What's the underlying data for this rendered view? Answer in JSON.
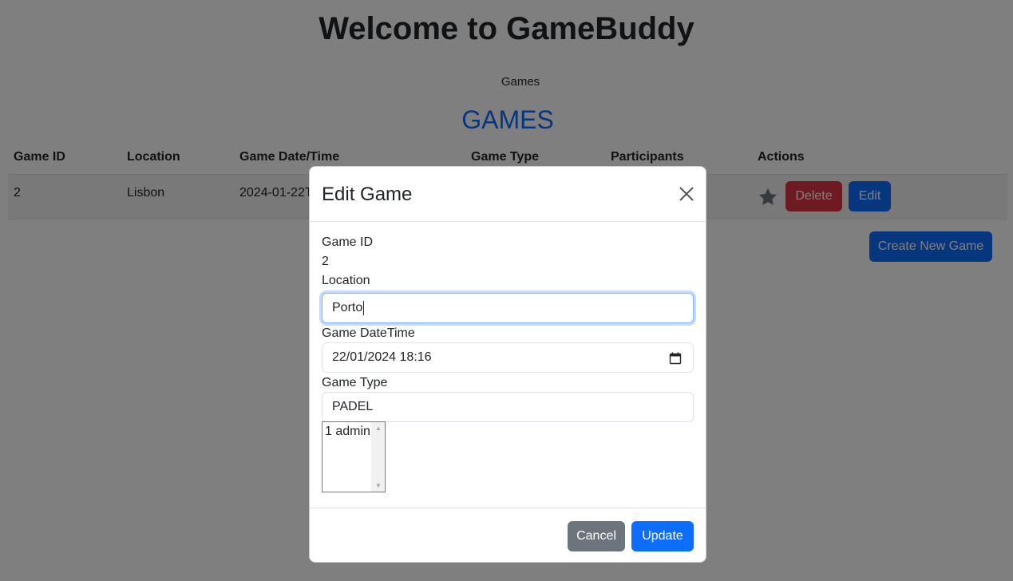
{
  "page": {
    "title": "Welcome to GameBuddy",
    "nav_link": "Games",
    "section_heading": "GAMES",
    "create_button": "Create New Game"
  },
  "table": {
    "headers": [
      "Game ID",
      "Location",
      "Game Date/Time",
      "Game Type",
      "Participants",
      "Actions"
    ],
    "rows": [
      {
        "id": "2",
        "location": "Lisbon",
        "datetime": "2024-01-22T",
        "type": "",
        "participants": ""
      }
    ],
    "delete_label": "Delete",
    "edit_label": "Edit",
    "favorite_icon": "star-icon"
  },
  "modal": {
    "title": "Edit Game",
    "close_icon": "close-icon",
    "game_id_label": "Game ID",
    "game_id_value": "2",
    "location_label": "Location",
    "location_value": "Porto",
    "datetime_label": "Game DateTime",
    "datetime_value": "22/01/2024 18:16",
    "calendar_icon": "calendar-icon",
    "type_label": "Game Type",
    "type_value": "PADEL",
    "participants_options": [
      "1 admin"
    ],
    "cancel_label": "Cancel",
    "update_label": "Update"
  },
  "colors": {
    "primary": "#0d6efd",
    "danger": "#dc3545",
    "secondary": "#6c757d",
    "focus": "#86b7fe"
  }
}
